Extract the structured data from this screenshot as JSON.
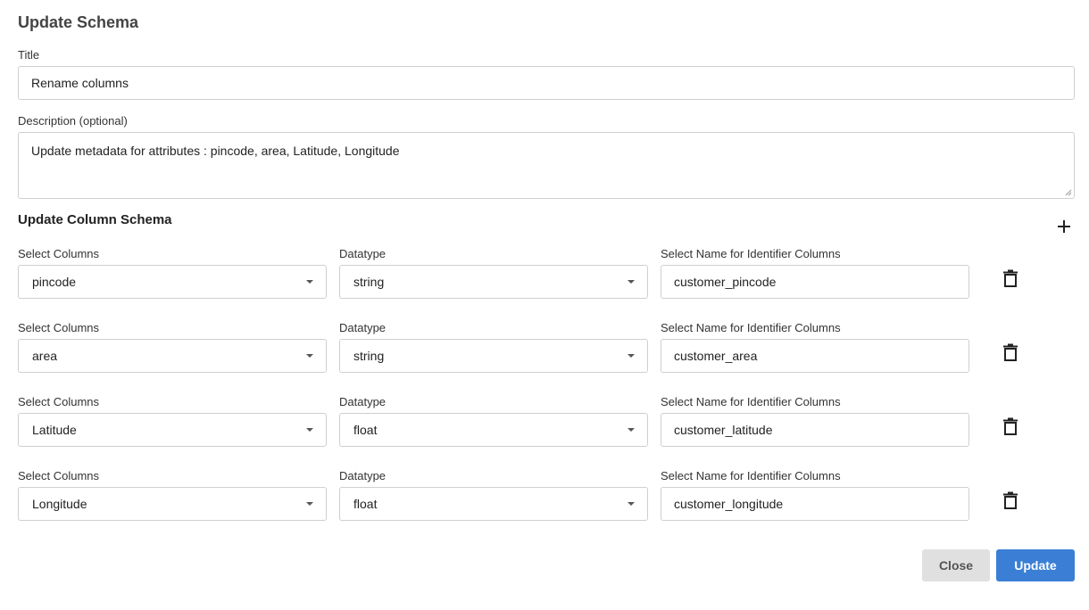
{
  "dialog": {
    "heading": "Update Schema"
  },
  "form": {
    "title_label": "Title",
    "title_value": "Rename columns",
    "description_label": "Description (optional)",
    "description_value": "Update metadata for attributes : pincode, area, Latitude, Longitude"
  },
  "schema": {
    "section_title": "Update Column Schema",
    "add_icon": "plus-icon",
    "delete_icon": "trash-icon",
    "rows": [
      {
        "column_label": "Select Columns",
        "column_value": "pincode",
        "datatype_label": "Datatype",
        "datatype_value": "string",
        "identifier_label": "Select Name for Identifier Columns",
        "identifier_value": "customer_pincode"
      },
      {
        "column_label": "Select Columns",
        "column_value": "area",
        "datatype_label": "Datatype",
        "datatype_value": "string",
        "identifier_label": "Select Name for Identifier Columns",
        "identifier_value": "customer_area"
      },
      {
        "column_label": "Select Columns",
        "column_value": "Latitude",
        "datatype_label": "Datatype",
        "datatype_value": "float",
        "identifier_label": "Select Name for Identifier Columns",
        "identifier_value": "customer_latitude"
      },
      {
        "column_label": "Select Columns",
        "column_value": "Longitude",
        "datatype_label": "Datatype",
        "datatype_value": "float",
        "identifier_label": "Select Name for Identifier Columns",
        "identifier_value": "customer_longitude"
      }
    ]
  },
  "actions": {
    "close_label": "Close",
    "update_label": "Update"
  },
  "colors": {
    "primary": "#3a7fd5",
    "secondary": "#e0e0e0",
    "border": "#cfcfcf"
  }
}
